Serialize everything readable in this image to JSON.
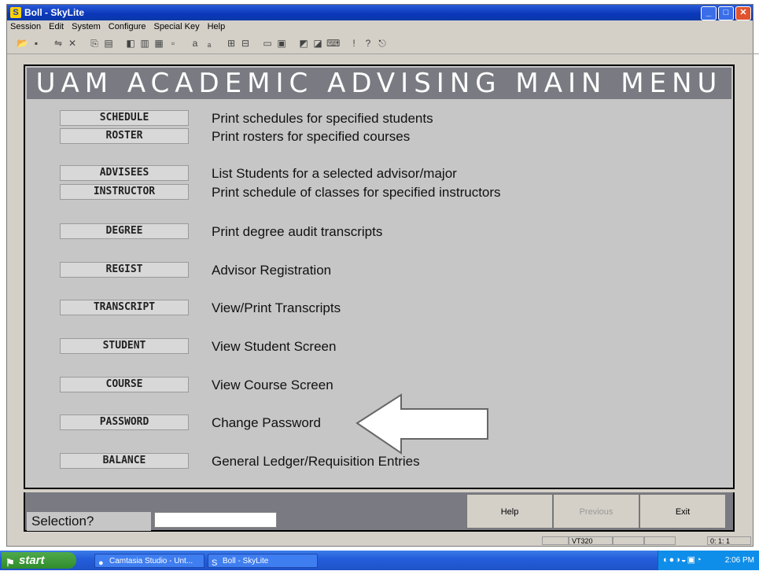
{
  "window": {
    "title": "Boll - SkyLite",
    "icon_glyph": "S"
  },
  "menubar": [
    "Session",
    "Edit",
    "System",
    "Configure",
    "Special Key",
    "Help"
  ],
  "toolbar_icons": [
    "open-icon",
    "save-icon",
    "connect-icon",
    "disconnect-icon",
    "copy-icon",
    "paste-icon",
    "capture-icon",
    "print-icon",
    "split-icon",
    "clear-icon",
    "font-icon",
    "font-small-icon",
    "send-icon",
    "receive-icon",
    "display-icon",
    "setup-icon",
    "macro-icon",
    "record-icon",
    "keyboard-icon",
    "info-icon",
    "help-pointer-icon",
    "exit-icon"
  ],
  "banner": "UAM ACADEMIC ADVISING MAIN MENU",
  "menu_items": [
    {
      "key": "schedule",
      "button": "SCHEDULE",
      "desc": "Print schedules for specified students"
    },
    {
      "key": "roster",
      "button": "ROSTER",
      "desc": "Print rosters for specified courses"
    },
    {
      "key": "advisees",
      "button": "ADVISEES",
      "desc": "List Students for a selected advisor/major"
    },
    {
      "key": "instructor",
      "button": "INSTRUCTOR",
      "desc": "Print schedule of classes for specified instructors"
    },
    {
      "key": "degree",
      "button": "DEGREE",
      "desc": "Print degree audit transcripts"
    },
    {
      "key": "regist",
      "button": "REGIST",
      "desc": "Advisor Registration"
    },
    {
      "key": "transcript",
      "button": "TRANSCRIPT",
      "desc": "View/Print Transcripts"
    },
    {
      "key": "student",
      "button": "STUDENT",
      "desc": "View Student Screen"
    },
    {
      "key": "course",
      "button": "COURSE",
      "desc": "View Course Screen"
    },
    {
      "key": "password",
      "button": "PASSWORD",
      "desc": "Change Password"
    },
    {
      "key": "balance",
      "button": "BALANCE",
      "desc": "General Ledger/Requisition Entries"
    }
  ],
  "selection": {
    "label": "Selection?",
    "value": ""
  },
  "function_buttons": {
    "help": "Help",
    "previous": "Previous",
    "exit": "Exit"
  },
  "statusbar": {
    "terminal": "VT320",
    "position": "0: 1: 1"
  },
  "taskbar": {
    "start": "start",
    "tasks": [
      "Camtasia Studio - Unt...",
      "Boll - SkyLite"
    ],
    "clock": "2:06 PM"
  },
  "colors": {
    "banner_bg": "#7a7a82",
    "screen_bg": "#c6c6c6",
    "titlebar": "#0a36b8"
  }
}
